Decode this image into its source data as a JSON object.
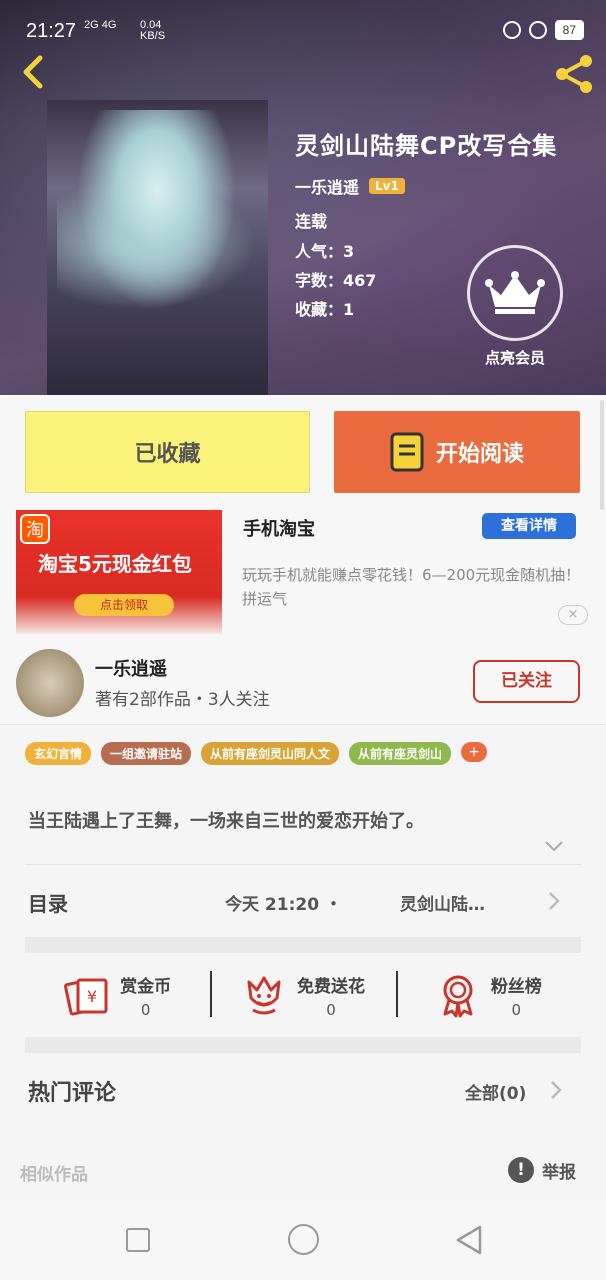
{
  "status_bar": {
    "time": "21:27",
    "network_1": "2G",
    "network_2": "4G",
    "speed_value": "0.04",
    "speed_unit": "KB/S",
    "battery": "87"
  },
  "book": {
    "title": "灵剑山陆舞CP改写合集",
    "author": "一乐逍遥",
    "level": "Lv1",
    "status": "连载",
    "popularity_label": "人气：",
    "popularity": "3",
    "words_label": "字数：",
    "words": "467",
    "favorites_label": "收藏：",
    "favorites": "1"
  },
  "vip": {
    "label": "点亮会员"
  },
  "actions": {
    "favorited_label": "已收藏",
    "read_label": "开始阅读"
  },
  "ad": {
    "banner_text": "淘宝5元现金红包",
    "banner_logo": "淘",
    "banner_button": "点击领取",
    "title": "手机淘宝",
    "detail_button": "查看详情",
    "description": "玩玩手机就能赚点零花钱！6—200元现金随机抽！拼运气",
    "close": "×"
  },
  "author_card": {
    "name": "一乐逍遥",
    "stats": "著有2部作品・3人关注",
    "follow_label": "已关注"
  },
  "tags": [
    {
      "label": "玄幻言情",
      "color": "#f0b23a"
    },
    {
      "label": "一组邀请驻站",
      "color": "#b86d52"
    },
    {
      "label": "从前有座剑灵山同人文",
      "color": "#d9a437"
    },
    {
      "label": "从前有座灵剑山",
      "color": "#8fb84e"
    }
  ],
  "tag_add": "+",
  "description": "当王陆遇上了王舞，一场来自三世的爱恋开始了。",
  "toc": {
    "label": "目录",
    "date": "今天  21:20  ・",
    "latest_chapter": "灵剑山陆…"
  },
  "stats": [
    {
      "label": "赏金币",
      "count": "0",
      "icon": "red-envelope-icon"
    },
    {
      "label": "免费送花",
      "count": "0",
      "icon": "flower-icon"
    },
    {
      "label": "粉丝榜",
      "count": "0",
      "icon": "medal-icon"
    }
  ],
  "comments": {
    "label": "热门评论",
    "all_label": "全部(0)"
  },
  "footer": {
    "similar_label": "相似作品",
    "report_label": "举报",
    "report_icon": "!"
  },
  "colors": {
    "accent_orange": "#e96b3e",
    "favorite_yellow": "#fbf27a",
    "follow_red": "#c9352b",
    "ad_blue": "#2d70d8",
    "level_badge": "#f0b23a"
  }
}
